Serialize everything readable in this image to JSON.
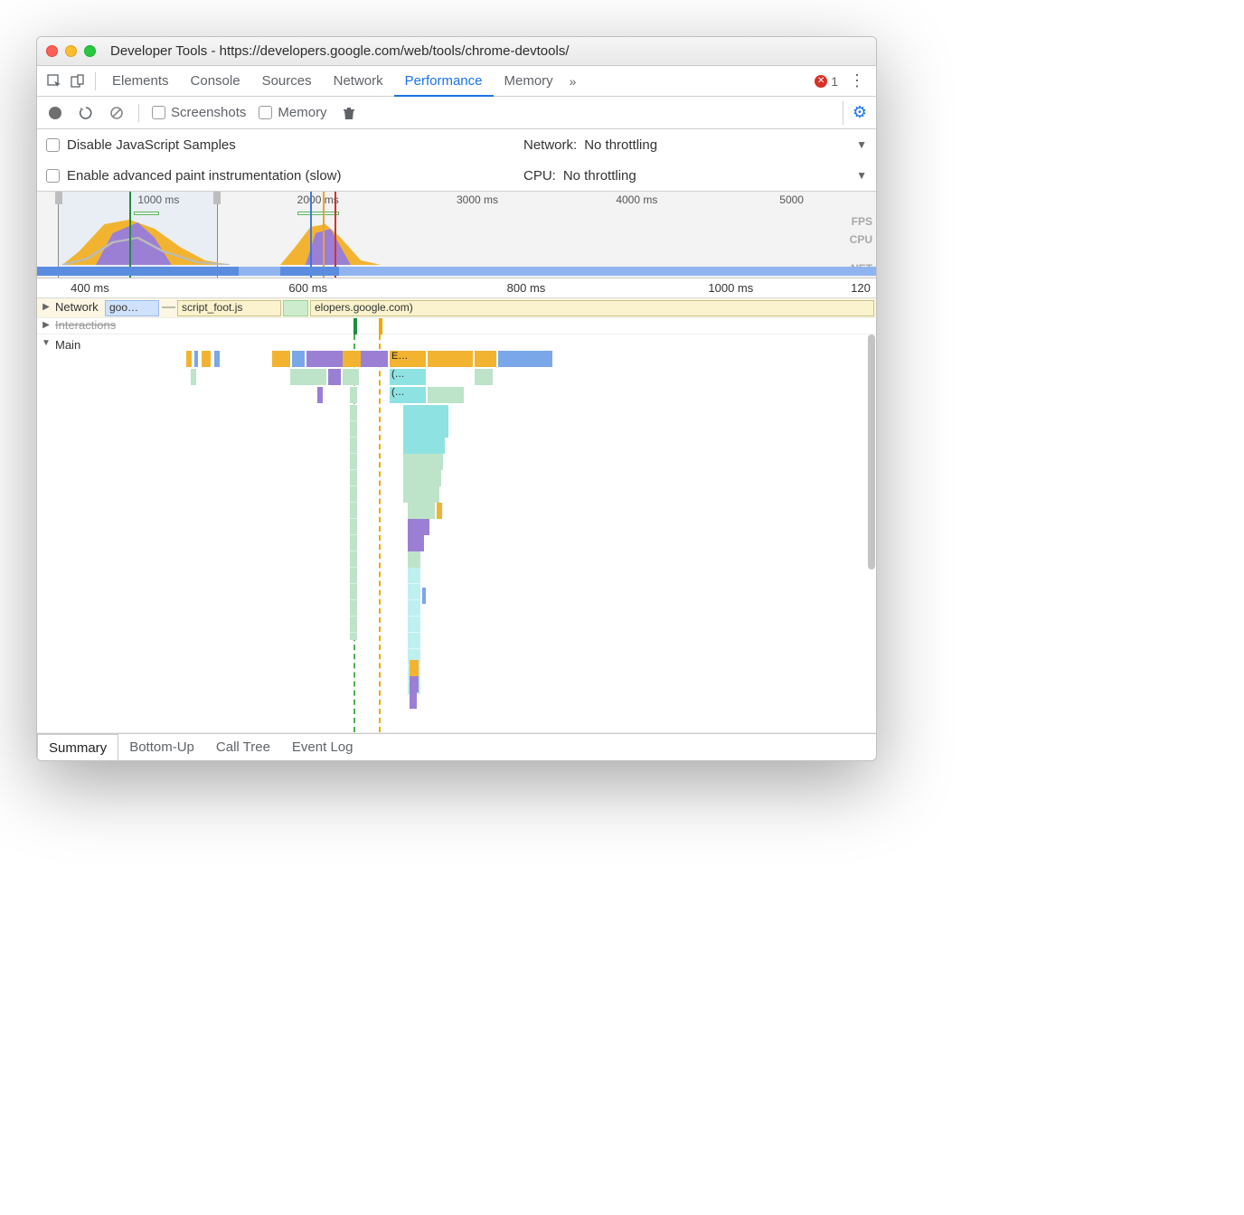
{
  "window": {
    "title": "Developer Tools - https://developers.google.com/web/tools/chrome-devtools/"
  },
  "tabs": {
    "items": [
      "Elements",
      "Console",
      "Sources",
      "Network",
      "Performance",
      "Memory"
    ],
    "active_index": 4,
    "error_count": "1"
  },
  "toolbar": {
    "screenshots_label": "Screenshots",
    "memory_label": "Memory"
  },
  "settings": {
    "disable_js_label": "Disable JavaScript Samples",
    "enable_paint_label": "Enable advanced paint instrumentation (slow)",
    "network_label": "Network:",
    "network_value": "No throttling",
    "cpu_label": "CPU:",
    "cpu_value": "No throttling"
  },
  "overview": {
    "ticks": [
      {
        "label": "1000 ms",
        "left_pct": 12
      },
      {
        "label": "2000 ms",
        "left_pct": 31
      },
      {
        "label": "3000 ms",
        "left_pct": 50
      },
      {
        "label": "4000 ms",
        "left_pct": 69
      },
      {
        "label": "5000",
        "left_pct": 88.5
      }
    ],
    "lane_labels": [
      "FPS",
      "CPU",
      "NET"
    ]
  },
  "detail_ruler": {
    "ticks": [
      {
        "label": "400 ms",
        "left_pct": 4
      },
      {
        "label": "600 ms",
        "left_pct": 30
      },
      {
        "label": "800 ms",
        "left_pct": 56
      },
      {
        "label": "1000 ms",
        "left_pct": 80
      },
      {
        "label": "120",
        "left_pct": 97
      }
    ]
  },
  "network_row": {
    "label": "Network",
    "items": [
      {
        "text": "goo…",
        "left_pct": 0,
        "width_pct": 9,
        "cls": "blue"
      },
      {
        "text": "script_foot.js",
        "left_pct": 11,
        "width_pct": 17,
        "cls": ""
      },
      {
        "text": "",
        "left_pct": 28,
        "width_pct": 4,
        "cls": "green"
      },
      {
        "text": "elopers.google.com)",
        "left_pct": 32.5,
        "width_pct": 70,
        "cls": ""
      }
    ]
  },
  "interactions_row": {
    "label": "Interactions"
  },
  "main_row": {
    "label": "Main",
    "task_labels": [
      "E…",
      "(…",
      "(…"
    ]
  },
  "bottom_tabs": {
    "items": [
      "Summary",
      "Bottom-Up",
      "Call Tree",
      "Event Log"
    ],
    "active_index": 0
  }
}
